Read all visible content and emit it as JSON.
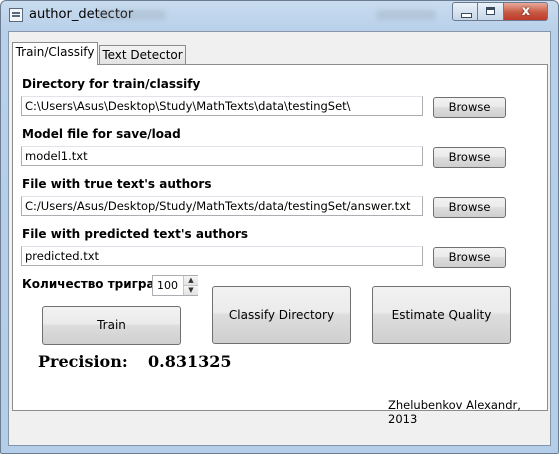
{
  "window": {
    "title": "author_detector",
    "close_glyph": "x"
  },
  "tabs": [
    {
      "label": "Train/Classify",
      "active": true
    },
    {
      "label": "Text Detector",
      "active": false
    }
  ],
  "form": {
    "dir_label": "Directory for train/classify",
    "dir_value": "C:\\Users\\Asus\\Desktop\\Study\\MathTexts\\data\\testingSet\\",
    "model_label": "Model file for save/load",
    "model_value": "model1.txt",
    "true_label": "File with true text's authors",
    "true_value": "C:/Users/Asus/Desktop/Study/MathTexts/data/testingSet/answer.txt",
    "pred_label": "File with predicted text's authors",
    "pred_value": "predicted.txt",
    "browse_label": "Browse",
    "trigram_label": "Количество триграмм",
    "trigram_value": "100",
    "spin_up": "▲",
    "spin_down": "▼"
  },
  "actions": {
    "train": "Train",
    "classify": "Classify Directory",
    "estimate": "Estimate Quality"
  },
  "result": {
    "precision_label": "Precision:",
    "precision_value": "0.831325"
  },
  "footer": {
    "author": "Zhelubenkov Alexandr, 2013"
  },
  "icons": [
    "app-icon",
    "minimize-icon",
    "maximize-icon",
    "close-icon"
  ]
}
